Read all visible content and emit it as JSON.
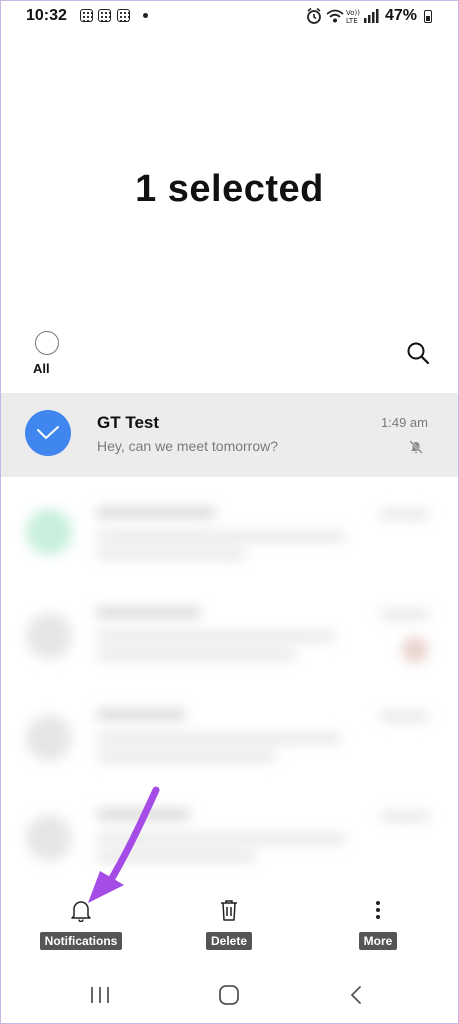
{
  "status_bar": {
    "time": "10:32",
    "battery_percent": "47%"
  },
  "page_title": "1 selected",
  "select_all": {
    "label": "All"
  },
  "selected_conversation": {
    "name": "GT Test",
    "preview": "Hey, can we meet tomorrow?",
    "time": "1:49 am"
  },
  "bottom_actions": [
    {
      "label": "Notifications",
      "icon": "bell-icon"
    },
    {
      "label": "Delete",
      "icon": "trash-icon"
    },
    {
      "label": "More",
      "icon": "more-vertical-icon"
    }
  ],
  "colors": {
    "accent": "#3f86ee",
    "selected_row": "#ececec",
    "annotation_arrow": "#a64ce6"
  }
}
